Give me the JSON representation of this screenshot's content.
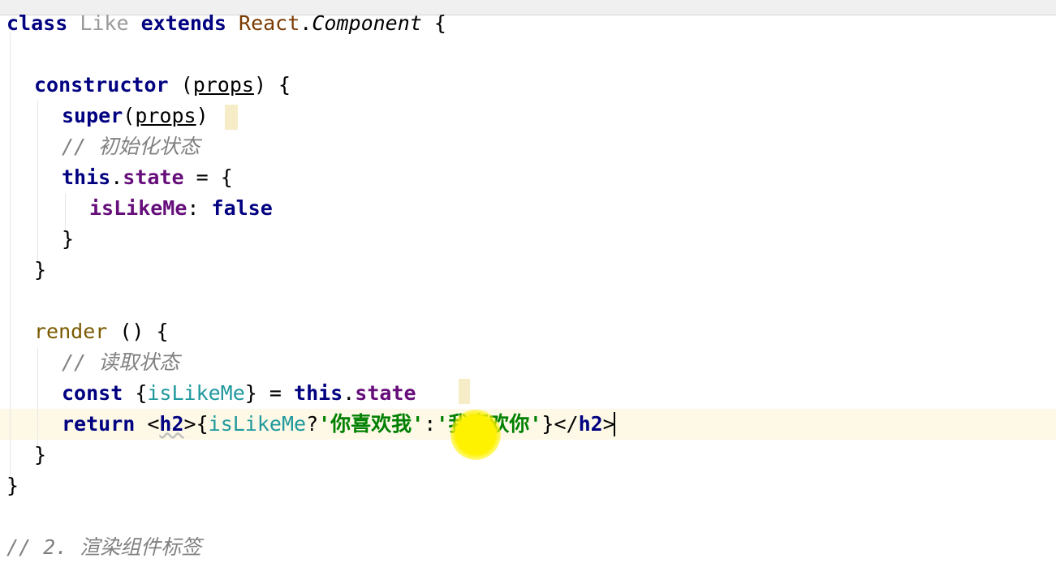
{
  "editor": {
    "language": "javascript",
    "lines": {
      "l1": [
        "class",
        "Like",
        "extends",
        "React",
        ".",
        "Component",
        " {"
      ],
      "l2": [
        "constructor",
        " (",
        "props",
        ") {"
      ],
      "l3": [
        "super",
        "(",
        "props",
        ")"
      ],
      "l4": "// 初始化状态",
      "l5": [
        "this",
        ".",
        "state",
        " = {"
      ],
      "l6": [
        "isLikeMe",
        ": ",
        "false"
      ],
      "l7": "}",
      "l8": "}",
      "l9": [
        "render",
        " () {"
      ],
      "l10": "// 读取状态",
      "l11": [
        "const",
        " {",
        "isLikeMe",
        "} = ",
        "this",
        ".",
        "state"
      ],
      "l12": [
        "return",
        " <",
        "h2",
        ">{",
        "isLikeMe",
        "?",
        "'你喜欢我'",
        ":",
        "'我喜欢你'",
        "}</",
        "h2",
        ">"
      ],
      "l13": "}",
      "l14": "}",
      "l15": "// 2. 渲染组件标签"
    }
  },
  "colors": {
    "keyword": "#000080",
    "property": "#660e7a",
    "identifier": "#20999d",
    "string": "#008000",
    "comment": "#808080",
    "current_line": "#fdf9e6",
    "bracket_match": "#f6edc8",
    "pointer": "#fff200"
  }
}
